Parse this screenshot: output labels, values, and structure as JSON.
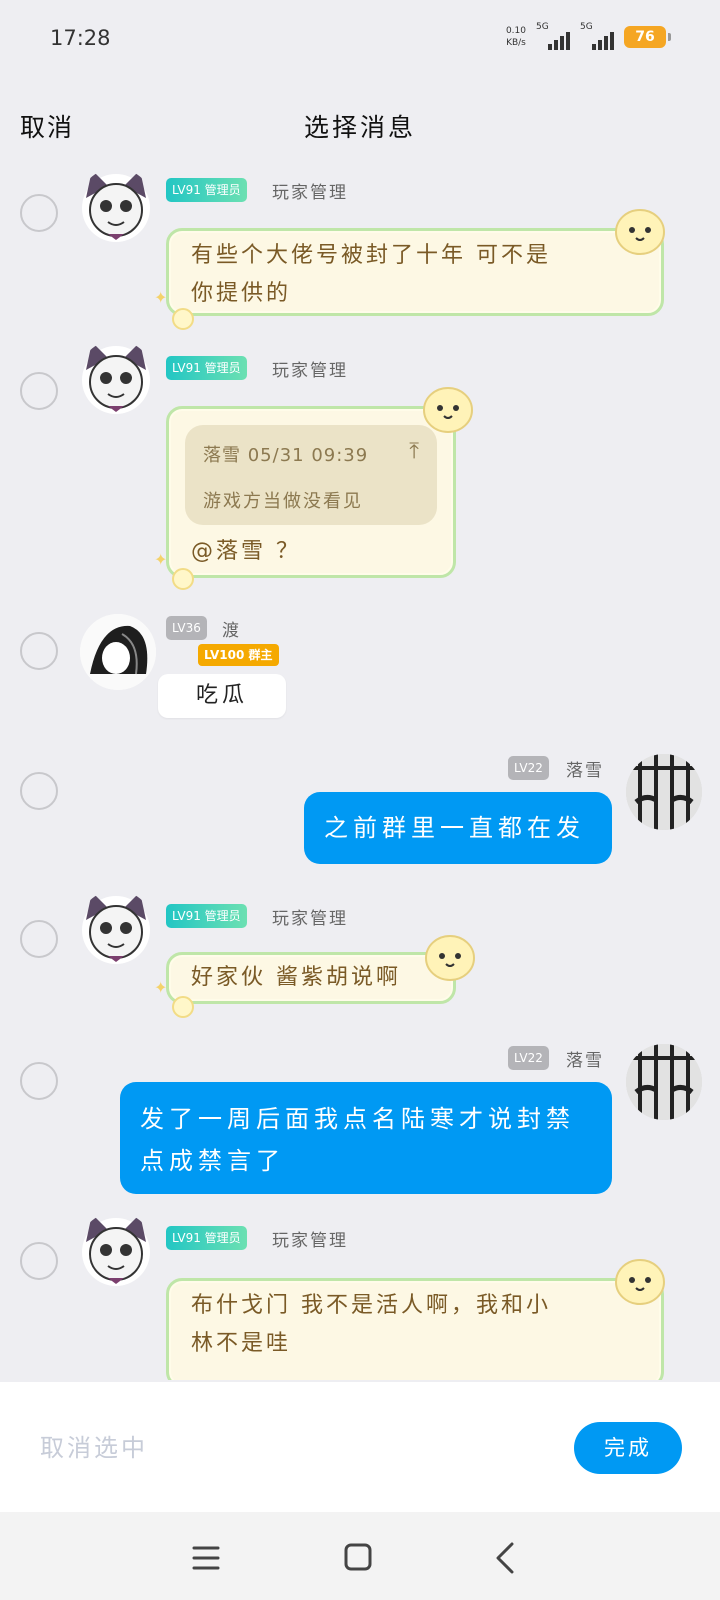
{
  "status_bar": {
    "time": "17:28",
    "net_speed_value": "0.10",
    "net_speed_unit": "KB/s",
    "sim1": "5G",
    "sim2": "5G",
    "battery": "76",
    "battery_color": "#f5a623"
  },
  "header": {
    "cancel_label": "取消",
    "title": "选择消息"
  },
  "messages": [
    {
      "sender": "玩家管理",
      "level": "LV91 管理员",
      "lines": [
        "有些个大佬号被封了十年 可不是",
        "你提供的"
      ],
      "bubble_style": "decorated"
    },
    {
      "sender": "玩家管理",
      "level": "LV91 管理员",
      "quote": {
        "author_time": "落雪 05/31 09:39",
        "text": "游戏方当做没看见",
        "jump_icon": "arrow-up-icon"
      },
      "text": "@落雪 ？",
      "bubble_style": "decorated"
    },
    {
      "sender": "渡",
      "level": "LV36",
      "badge": "LV100 群主",
      "text": "吃瓜",
      "bubble_style": "plain"
    },
    {
      "sender": "落雪",
      "level": "LV22",
      "text": "之前群里一直都在发",
      "bubble_style": "self"
    },
    {
      "sender": "玩家管理",
      "level": "LV91 管理员",
      "text": "好家伙 酱紫胡说啊",
      "bubble_style": "decorated"
    },
    {
      "sender": "落雪",
      "level": "LV22",
      "lines": [
        "发了一周后面我点名陆寒才说封禁",
        "点成禁言了"
      ],
      "bubble_style": "self"
    },
    {
      "sender": "玩家管理",
      "level": "LV91 管理员",
      "lines": [
        "布什戈门 我不是活人啊，我和小",
        "林不是哇"
      ],
      "bubble_style": "decorated"
    }
  ],
  "bottom_bar": {
    "unselect_label": "取消选中",
    "done_label": "完成"
  },
  "nav_bar": {
    "menu_icon": "menu-icon",
    "home_icon": "home-square-icon",
    "back_icon": "back-chevron-icon"
  },
  "colors": {
    "accent_blue": "#0099f3",
    "admin_badge": "#22c6c4",
    "host_badge": "#f5a900",
    "decorated_text": "#7a5a26"
  }
}
